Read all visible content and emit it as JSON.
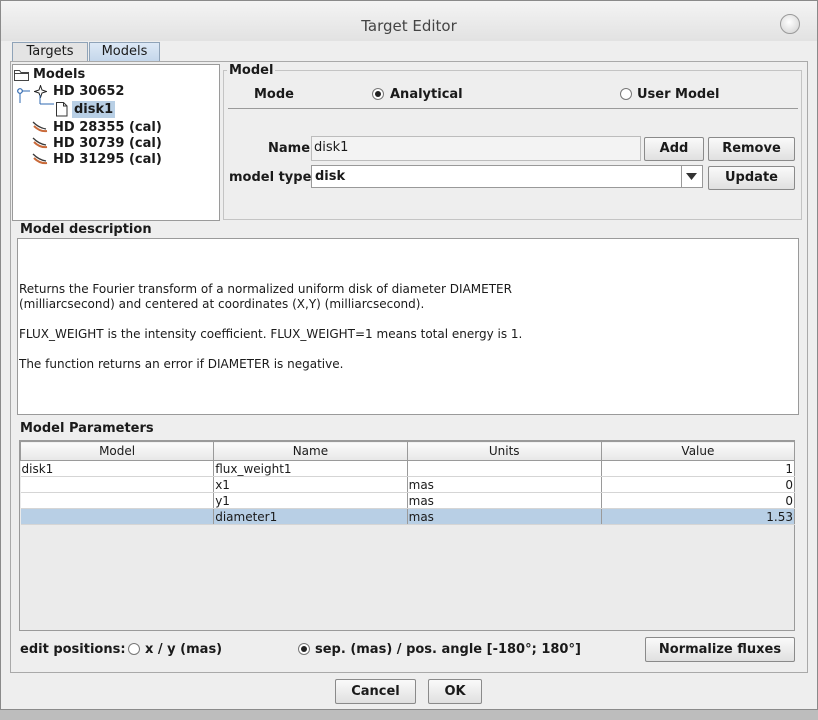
{
  "window": {
    "title": "Target Editor"
  },
  "tabs": [
    {
      "label": "Targets"
    },
    {
      "label": "Models"
    }
  ],
  "tree": {
    "root": "Models",
    "items": [
      {
        "label": "HD 30652"
      },
      {
        "label": "disk1"
      },
      {
        "label": "HD 28355 (cal)"
      },
      {
        "label": "HD 30739 (cal)"
      },
      {
        "label": "HD 31295 (cal)"
      }
    ]
  },
  "model_panel": {
    "legend": "Model",
    "mode_label": "Mode",
    "mode_analytical": "Analytical",
    "mode_user": "User Model",
    "name_label": "Name",
    "name_value": "disk1",
    "add_label": "Add",
    "remove_label": "Remove",
    "type_label": "model type",
    "type_value": "disk",
    "update_label": "Update"
  },
  "description": {
    "legend": "Model description",
    "lines": [
      "Returns the Fourier transform of a normalized uniform disk of diameter DIAMETER\n(milliarcsecond) and centered at coordinates (X,Y) (milliarcsecond).",
      "FLUX_WEIGHT is the intensity coefficient. FLUX_WEIGHT=1 means total energy is 1.",
      "The function returns an error if DIAMETER is negative."
    ]
  },
  "parameters": {
    "legend": "Model Parameters",
    "columns": [
      "Model",
      "Name",
      "Units",
      "Value"
    ],
    "rows": [
      {
        "model": "disk1",
        "name": "flux_weight1",
        "units": "",
        "value": "1"
      },
      {
        "model": "",
        "name": "x1",
        "units": "mas",
        "value": "0"
      },
      {
        "model": "",
        "name": "y1",
        "units": "mas",
        "value": "0"
      },
      {
        "model": "",
        "name": "diameter1",
        "units": "mas",
        "value": "1.53"
      }
    ]
  },
  "edit_positions": {
    "label": "edit positions:",
    "opt_xy": "x / y (mas)",
    "opt_sep": "sep. (mas) / pos. angle [-180°; 180°]",
    "normalize_label": "Normalize fluxes"
  },
  "footer": {
    "cancel_label": "Cancel",
    "ok_label": "OK"
  },
  "colors": {
    "selection": "#b8cfe5",
    "tab_active": "#c3d6ea"
  }
}
